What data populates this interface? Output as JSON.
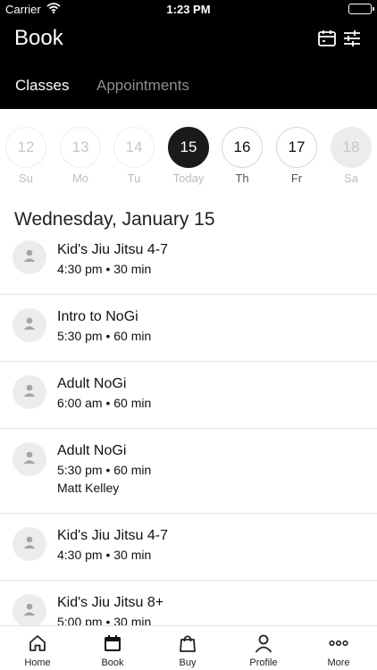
{
  "status_bar": {
    "carrier": "Carrier",
    "time": "1:23 PM"
  },
  "header": {
    "title": "Book",
    "tabs": [
      {
        "label": "Classes",
        "active": true
      },
      {
        "label": "Appointments",
        "active": false
      }
    ]
  },
  "days": [
    {
      "number": "12",
      "label": "Su",
      "state": "past"
    },
    {
      "number": "13",
      "label": "Mo",
      "state": "past"
    },
    {
      "number": "14",
      "label": "Tu",
      "state": "past"
    },
    {
      "number": "15",
      "label": "Today",
      "state": "selected"
    },
    {
      "number": "16",
      "label": "Th",
      "state": "available"
    },
    {
      "number": "17",
      "label": "Fr",
      "state": "available"
    },
    {
      "number": "18",
      "label": "Sa",
      "state": "disabled"
    }
  ],
  "date_heading": "Wednesday, January 15",
  "classes": [
    {
      "name": "Kid's Jiu Jitsu 4-7",
      "time": "4:30 pm • 30 min",
      "instructor": ""
    },
    {
      "name": "Intro to NoGi",
      "time": "5:30 pm • 60 min",
      "instructor": ""
    },
    {
      "name": "Adult NoGi",
      "time": "6:00 am • 60 min",
      "instructor": ""
    },
    {
      "name": "Adult NoGi",
      "time": "5:30 pm • 60 min",
      "instructor": "Matt Kelley"
    },
    {
      "name": "Kid's Jiu Jitsu 4-7",
      "time": "4:30 pm • 30 min",
      "instructor": ""
    },
    {
      "name": "Kid's Jiu Jitsu 8+",
      "time": "5:00 pm • 30 min",
      "instructor": ""
    }
  ],
  "tab_bar": [
    {
      "label": "Home",
      "icon": "home-icon"
    },
    {
      "label": "Book",
      "icon": "calendar-icon"
    },
    {
      "label": "Buy",
      "icon": "shopping-bag-icon"
    },
    {
      "label": "Profile",
      "icon": "person-icon"
    },
    {
      "label": "More",
      "icon": "more-icon"
    }
  ]
}
